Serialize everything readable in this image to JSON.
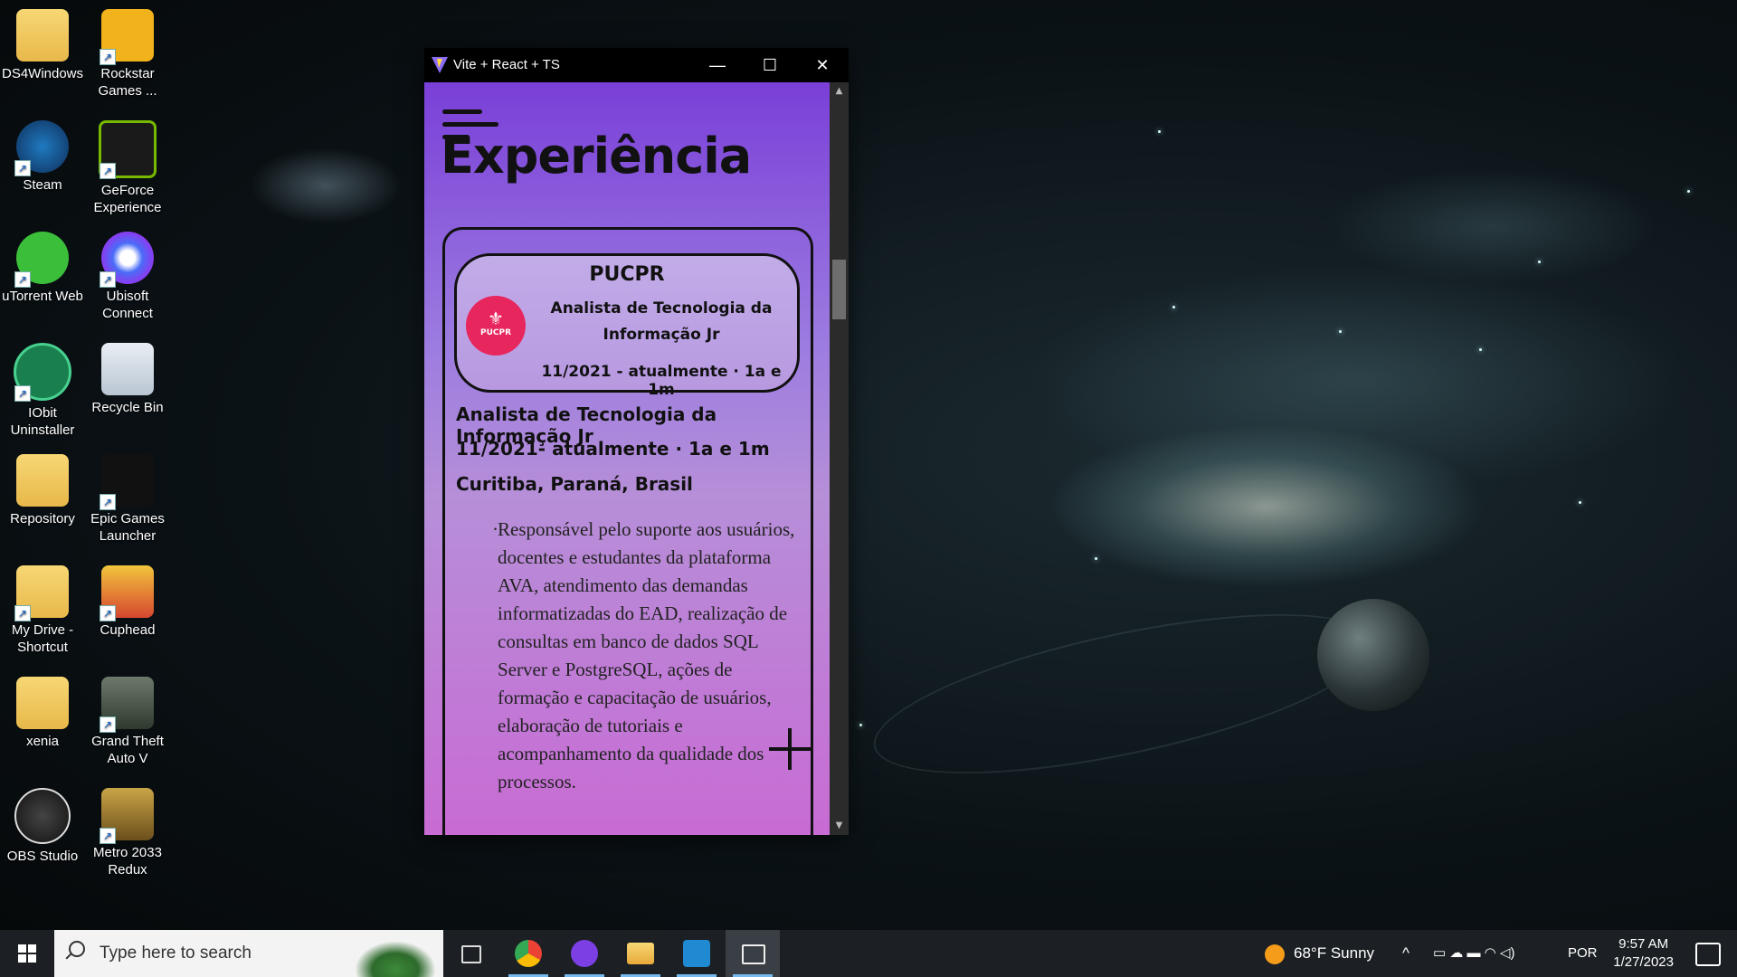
{
  "desktop": {
    "icons": [
      {
        "label": "DS4Windows",
        "icon": "folder-icon"
      },
      {
        "label": "Rockstar Games ...",
        "icon": "rockstar-icon"
      },
      {
        "label": "Steam",
        "icon": "steam-icon"
      },
      {
        "label": "GeForce Experience",
        "icon": "nvidia-icon"
      },
      {
        "label": "uTorrent Web",
        "icon": "utorrent-icon"
      },
      {
        "label": "Ubisoft Connect",
        "icon": "ubisoft-icon"
      },
      {
        "label": "IObit Uninstaller",
        "icon": "iobit-icon"
      },
      {
        "label": "Recycle Bin",
        "icon": "recycle-bin-icon"
      },
      {
        "label": "Repository",
        "icon": "folder-icon"
      },
      {
        "label": "Epic Games Launcher",
        "icon": "epic-icon"
      },
      {
        "label": "My Drive - Shortcut",
        "icon": "drive-folder-icon"
      },
      {
        "label": "Cuphead",
        "icon": "cuphead-icon"
      },
      {
        "label": "xenia",
        "icon": "folder-icon"
      },
      {
        "label": "Grand Theft Auto V",
        "icon": "gta-icon"
      },
      {
        "label": "OBS Studio",
        "icon": "obs-icon"
      },
      {
        "label": "Metro 2033 Redux",
        "icon": "metro-icon"
      }
    ]
  },
  "window": {
    "title": "Vite + React + TS",
    "minimize_glyph": "—",
    "maximize_glyph": "☐",
    "close_glyph": "✕"
  },
  "page": {
    "heading": "Experiência",
    "card": {
      "company": "PUCPR",
      "logo_text": "PUCPR",
      "role": "Analista de Tecnologia da Informação Jr",
      "period": "11/2021 - atualmente · 1a e 1m"
    },
    "details": {
      "role": "Analista de Tecnologia da Informação Jr",
      "period": "11/2021- atualmente · 1a e 1m",
      "location": "Curitiba, Paraná, Brasil",
      "description": "Responsável pelo suporte aos usuários, docentes e estudantes da plataforma AVA, atendimento das demandas informatizadas do EAD, realização de consultas em banco de dados SQL Server e PostgreSQL, ações de formação e capacitação de usuários, elaboração de tutoriais e acompanhamento da qualidade dos processos."
    }
  },
  "taskbar": {
    "search_placeholder": "Type here to search",
    "weather": "68°F  Sunny",
    "language": "POR",
    "time": "9:57 AM",
    "date": "1/27/2023"
  },
  "colors": {
    "accent": "#76b9ed",
    "badge": "#e8265e",
    "window_bg_top": "#7a3fd8",
    "window_bg_bottom": "#c86bd4"
  }
}
